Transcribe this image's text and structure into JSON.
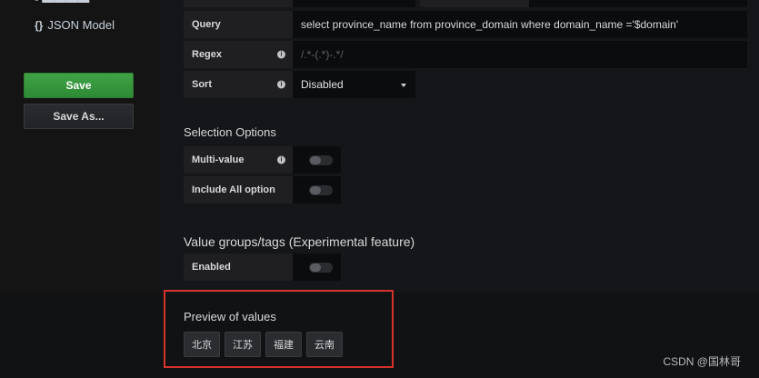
{
  "sidebar": {
    "json_model_label": "JSON Model",
    "json_icon": "{}",
    "save_label": "Save",
    "save_as_label": "Save As..."
  },
  "form": {
    "query": {
      "label": "Query",
      "value": "select province_name from province_domain where domain_name ='$domain'"
    },
    "regex": {
      "label": "Regex",
      "placeholder": "/.*-(.*)-.*/"
    },
    "sort": {
      "label": "Sort",
      "value": "Disabled"
    }
  },
  "selection_options": {
    "title": "Selection Options",
    "multi_value_label": "Multi-value",
    "include_all_label": "Include All option"
  },
  "value_groups": {
    "title": "Value groups/tags (Experimental feature)",
    "enabled_label": "Enabled"
  },
  "preview": {
    "title": "Preview of values",
    "values": [
      "北京",
      "江苏",
      "福建",
      "云南"
    ]
  },
  "watermark": "CSDN @国林哥",
  "colors": {
    "accent_green": "#3fa344",
    "highlight_red": "#d8322d"
  }
}
